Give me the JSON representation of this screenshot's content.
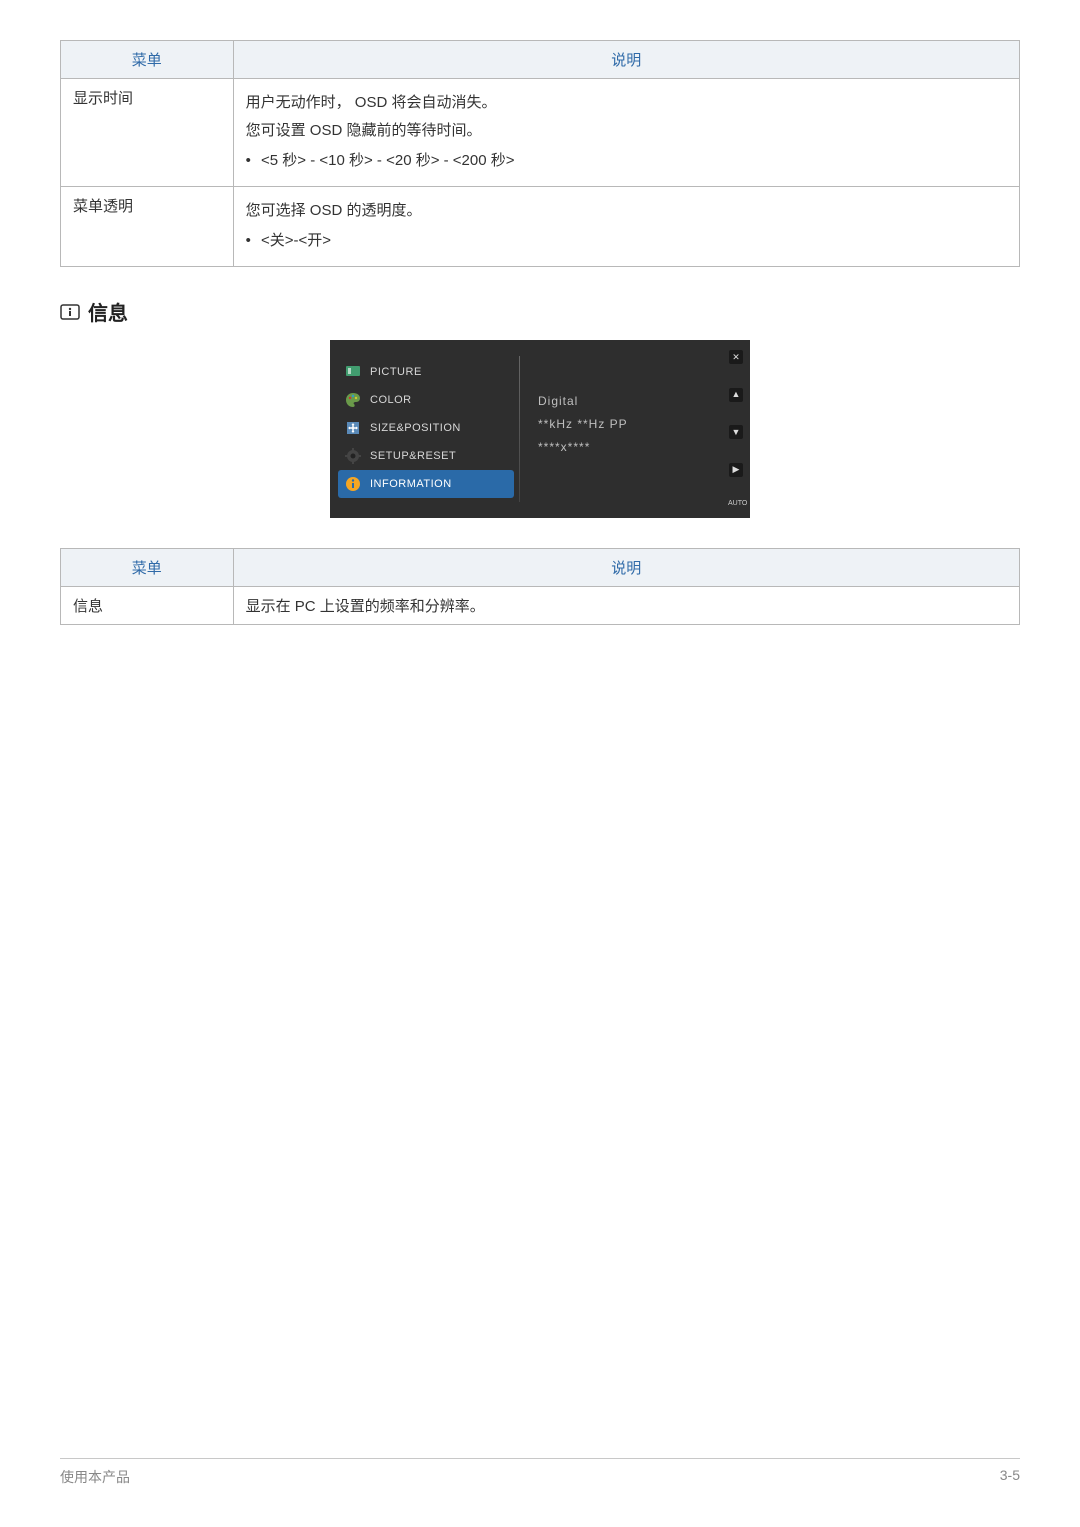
{
  "table1": {
    "header_menu": "菜单",
    "header_desc": "说明",
    "rows": [
      {
        "menu": "显示时间",
        "desc1": "用户无动作时， OSD 将会自动消失。",
        "desc2": "您可设置 OSD 隐藏前的等待时间。",
        "bullet": "<5 秒> - <10 秒> - <20 秒> - <200 秒>"
      },
      {
        "menu": "菜单透明",
        "desc1": "您可选择 OSD 的透明度。",
        "bullet": "<关>-<开>"
      }
    ]
  },
  "section_title": "信息",
  "osd": {
    "menu": {
      "picture": "PICTURE",
      "color": "COLOR",
      "size": "SIZE&POSITION",
      "setup": "SETUP&RESET",
      "info": "INFORMATION"
    },
    "right": {
      "line1": "Digital",
      "line2": "**kHz **Hz PP",
      "line3": "****x****"
    },
    "auto": "AUTO"
  },
  "table2": {
    "header_menu": "菜单",
    "header_desc": "说明",
    "row": {
      "menu": "信息",
      "desc": "显示在 PC 上设置的频率和分辨率。"
    }
  },
  "footer": {
    "left": "使用本产品",
    "right": "3-5"
  }
}
